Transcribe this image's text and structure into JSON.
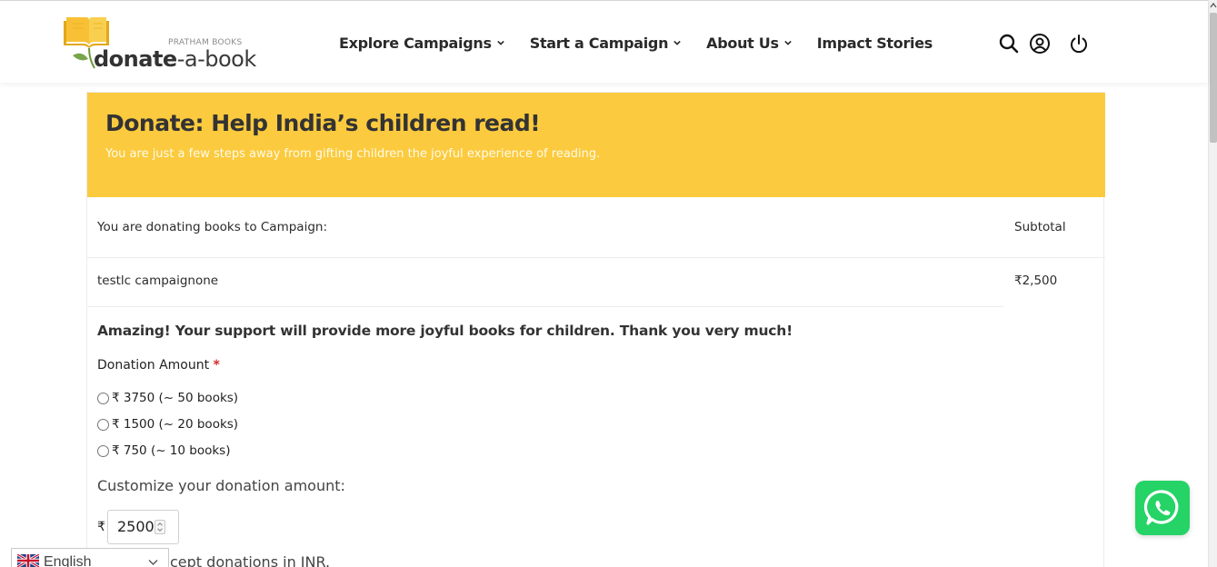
{
  "header": {
    "logo": {
      "small": "PRATHAM BOOKS",
      "main_bold": "donate",
      "main_rest": "-a-book"
    },
    "nav": [
      {
        "label": "Explore Campaigns",
        "has_dropdown": true
      },
      {
        "label": "Start a Campaign",
        "has_dropdown": true
      },
      {
        "label": "About Us",
        "has_dropdown": true
      },
      {
        "label": "Impact Stories",
        "has_dropdown": false
      }
    ],
    "icons": [
      "search-icon",
      "user-icon",
      "power-icon"
    ]
  },
  "banner": {
    "title": "Donate: Help India’s children read!",
    "subtitle": "You are just a few steps away from gifting children the joyful experience of reading.",
    "color": "#fbca3e"
  },
  "table": {
    "header_left": "You are donating books to Campaign:",
    "header_right": "Subtotal",
    "campaign_name": "testlc campaignone",
    "subtotal": "₹2,500"
  },
  "form": {
    "thanks": "Amazing! Your support will provide more joyful books for children. Thank you very much!",
    "amount_label": "Donation Amount",
    "required_mark": "*",
    "options": [
      {
        "label": "₹ 3750 (~ 50 books)",
        "selected": false
      },
      {
        "label": "₹ 1500 (~ 20 books)",
        "selected": false
      },
      {
        "label": "₹ 750 (~ 10 books)",
        "selected": false
      }
    ],
    "customize_label": "Customize your donation amount:",
    "currency_symbol": "₹",
    "custom_value": "2500",
    "inr_note": "cept donations in INR."
  },
  "language": {
    "selected": "English",
    "flag": "uk-flag-icon"
  },
  "whatsapp": {
    "icon": "whatsapp-icon",
    "color": "#25d366"
  }
}
